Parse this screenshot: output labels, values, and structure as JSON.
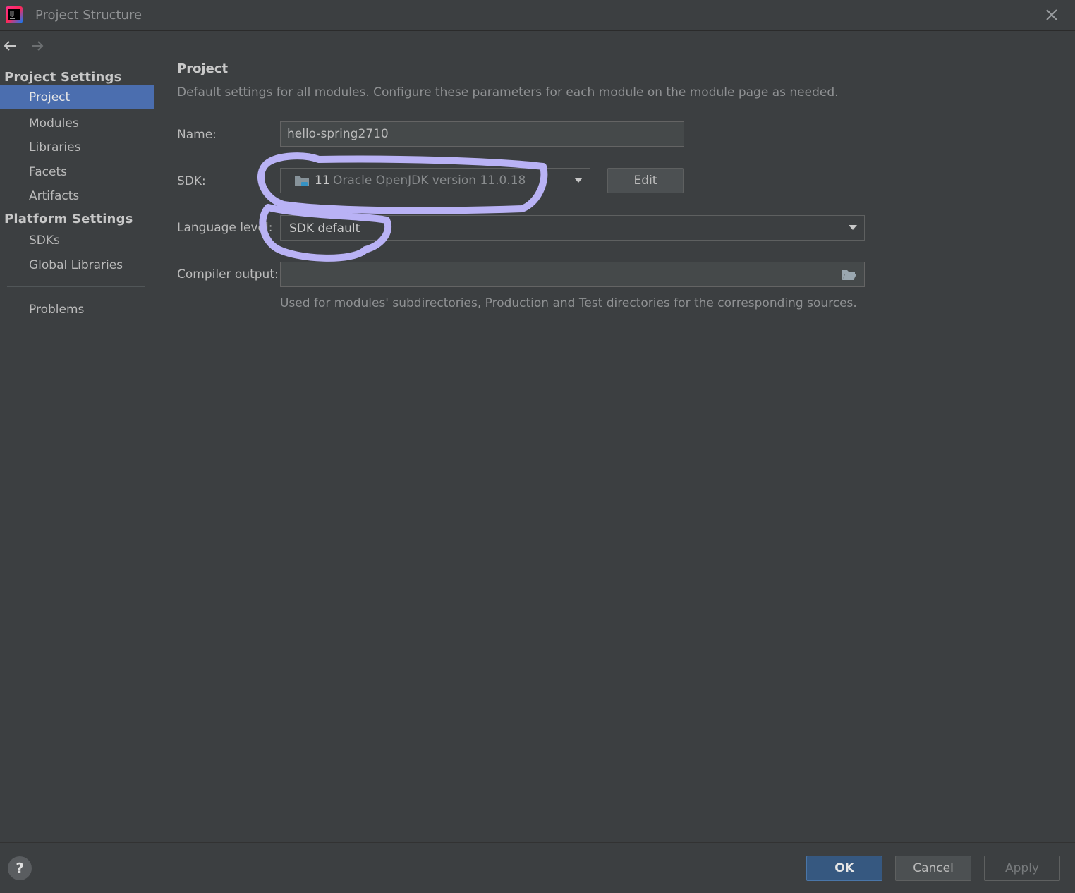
{
  "window": {
    "title": "Project Structure"
  },
  "sidebar": {
    "project_settings_header": "Project Settings",
    "project_items": [
      "Project",
      "Modules",
      "Libraries",
      "Facets",
      "Artifacts"
    ],
    "platform_settings_header": "Platform Settings",
    "platform_items": [
      "SDKs",
      "Global Libraries"
    ],
    "problems": "Problems",
    "selected": "Project"
  },
  "main": {
    "heading": "Project",
    "description": "Default settings for all modules. Configure these parameters for each module on the module page as needed.",
    "name_label": "Name:",
    "name_value": "hello-spring2710",
    "sdk_label": "SDK:",
    "sdk_version": "11",
    "sdk_name": "Oracle OpenJDK version 11.0.18",
    "edit_button": "Edit",
    "language_level_label": "Language level:",
    "language_level_value": "SDK default",
    "compiler_output_label": "Compiler output:",
    "compiler_output_value": "",
    "compiler_output_hint": "Used for modules' subdirectories, Production and Test directories for the corresponding sources."
  },
  "footer": {
    "help": "?",
    "ok": "OK",
    "cancel": "Cancel",
    "apply": "Apply"
  },
  "colors": {
    "background": "#3c3f41",
    "selection": "#4b6eaf",
    "ok_button": "#365880",
    "annotation": "#b9b2f5"
  },
  "icons": [
    "intellij-logo-icon",
    "close-icon",
    "back-arrow-icon",
    "forward-arrow-icon",
    "folder-sdk-icon",
    "dropdown-arrow-icon",
    "open-folder-icon",
    "help-icon"
  ]
}
